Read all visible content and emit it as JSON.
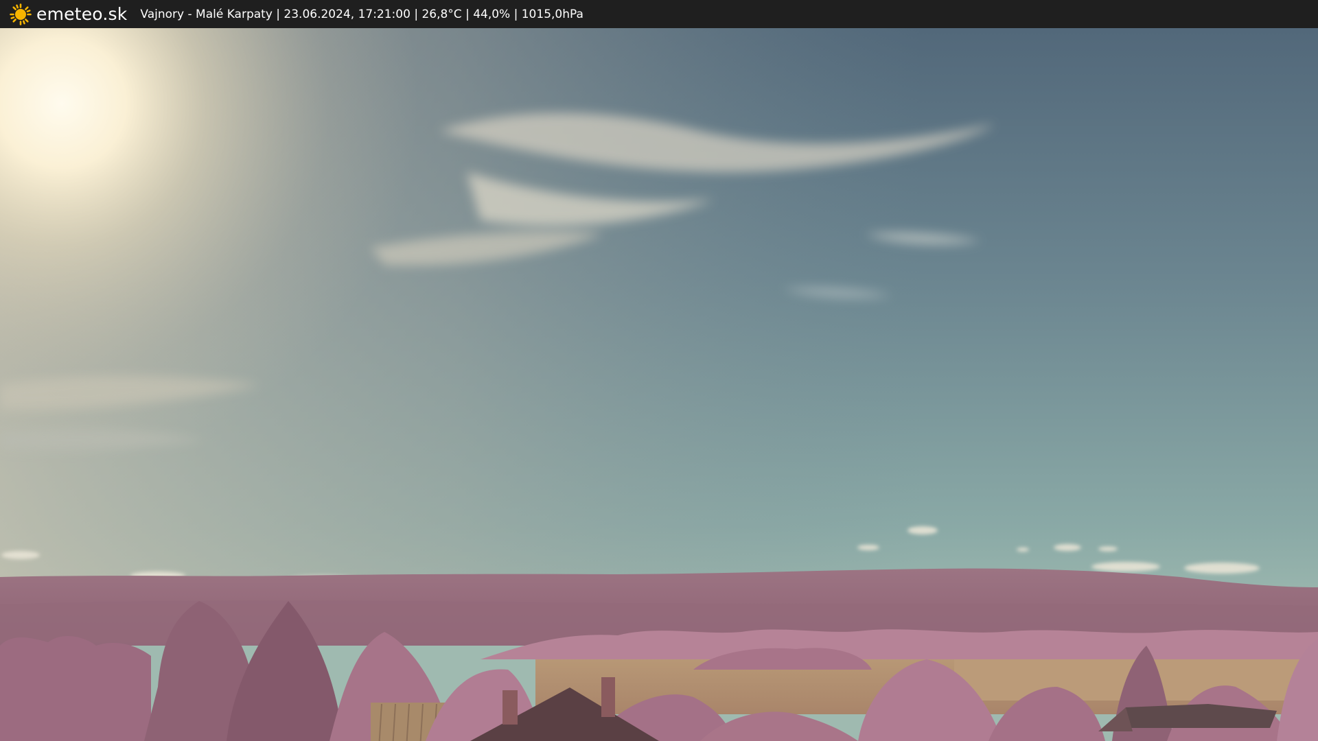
{
  "header": {
    "brand": "emeteo.sk",
    "caption": "Vajnory - Malé Karpaty | 23.06.2024, 17:21:00 | 26,8°C | 44,0% | 1015,0hPa",
    "logo_icon": "sun-icon"
  },
  "colors": {
    "bar_background": "#1f1f1f",
    "sun_yellow": "#f7b500",
    "sky_top": "#4f6676",
    "sky_horizon": "#92ada6",
    "vegetation": "#a5728a",
    "field": "#b59072"
  }
}
